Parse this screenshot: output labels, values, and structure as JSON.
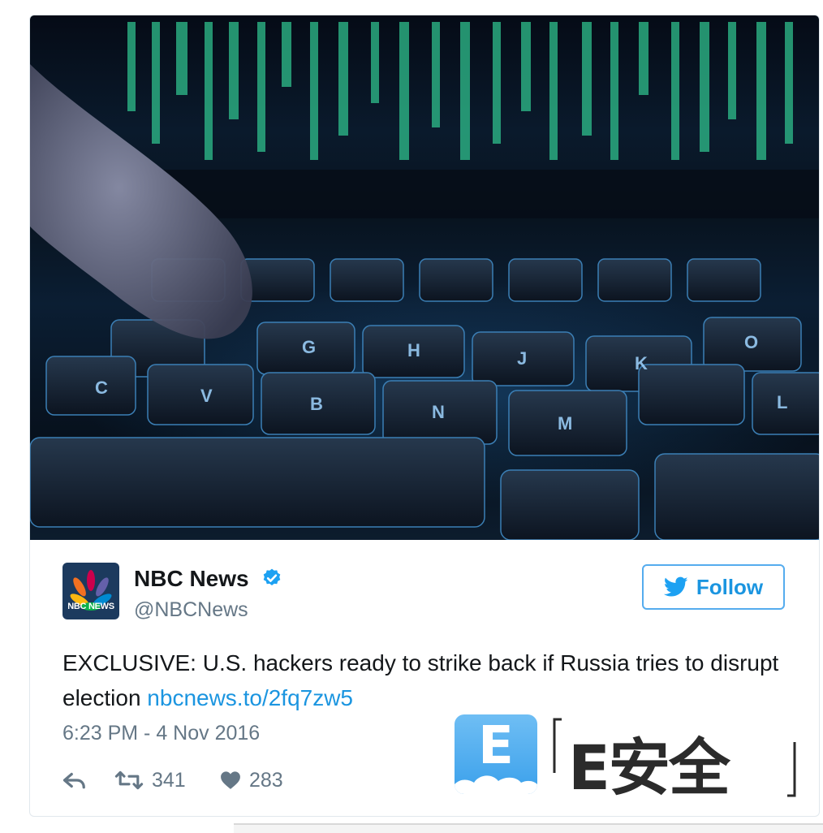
{
  "tweet": {
    "author_name": "NBC News",
    "author_handle": "@NBCNews",
    "avatar_label": "NBC NEWS",
    "follow_label": "Follow",
    "text": "EXCLUSIVE: U.S. hackers ready to strike back if Russia tries to disrupt election",
    "link": "nbcnews.to/2fq7zw5",
    "timestamp": "6:23 PM - 4 Nov 2016",
    "retweets": "341",
    "likes": "283",
    "verified": true
  },
  "media": {
    "keys": [
      "C",
      "V",
      "B",
      "N",
      "M",
      "G",
      "H",
      "J",
      "K",
      "L",
      "O"
    ]
  },
  "watermark": {
    "logo_letter": "E",
    "text": "E安全"
  },
  "colors": {
    "accent": "#1b95e0",
    "secondary_text": "#657786",
    "primary_text": "#14171a",
    "border": "#e1e8ed"
  }
}
